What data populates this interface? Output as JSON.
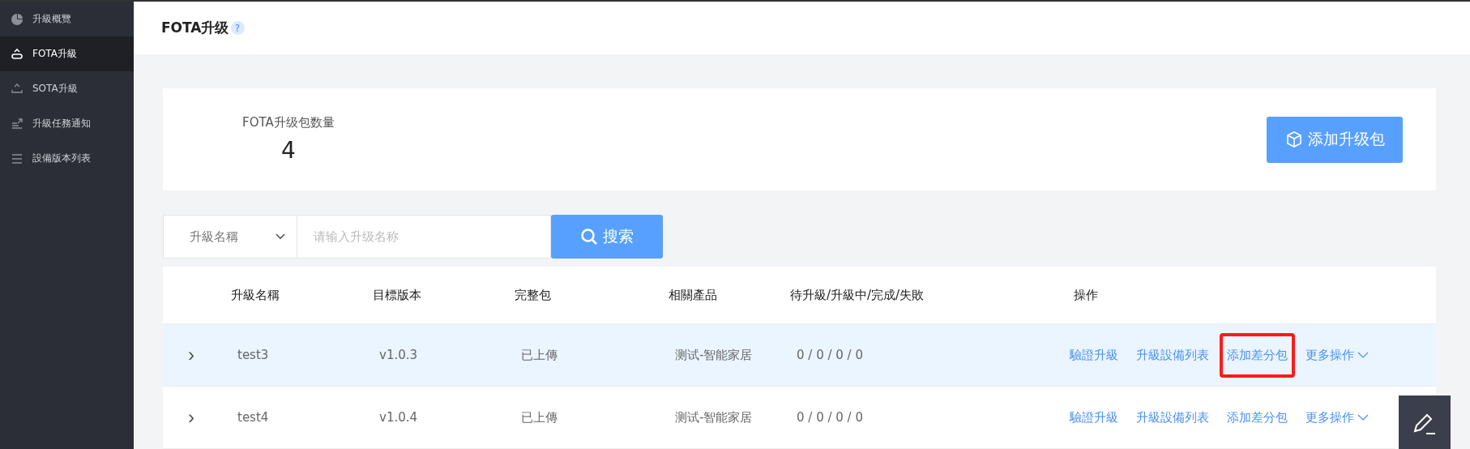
{
  "sidebar": {
    "items": [
      {
        "label": "升級概覽",
        "selected": false
      },
      {
        "label": "FOTA升級",
        "selected": true
      },
      {
        "label": "SOTA升級",
        "selected": false
      },
      {
        "label": "升級任務通知",
        "selected": false
      },
      {
        "label": "設備版本列表",
        "selected": false
      }
    ]
  },
  "header": {
    "title": "FOTA升级",
    "help": "?"
  },
  "stats": {
    "label": "FOTA升级包数量",
    "value": "4",
    "button": "添加升级包"
  },
  "search": {
    "field_select": "升級名稱",
    "placeholder": "请输入升级名称",
    "button": "搜索"
  },
  "table": {
    "columns": [
      "升級名稱",
      "目標版本",
      "完整包",
      "相關產品",
      "待升級/升級中/完成/失敗",
      "操作"
    ],
    "rows": [
      {
        "expander": "›",
        "selected": true,
        "cells": [
          "test3",
          "v1.0.3",
          "已上傳",
          "测试-智能家居",
          "0 / 0 / 0 / 0"
        ],
        "actions": [
          {
            "label": "驗證升級",
            "highlighted": false
          },
          {
            "label": "升級設備列表",
            "highlighted": false
          },
          {
            "label": "添加差分包",
            "highlighted": true
          },
          {
            "label": "更多操作",
            "highlighted": false,
            "kind": "dropdown"
          }
        ]
      },
      {
        "expander": "›",
        "selected": false,
        "cells": [
          "test4",
          "v1.0.4",
          "已上傳",
          "测试-智能家居",
          "0 / 0 / 0 / 0"
        ],
        "actions": [
          {
            "label": "驗證升級",
            "highlighted": false
          },
          {
            "label": "升級設備列表",
            "highlighted": false
          },
          {
            "label": "添加差分包",
            "highlighted": false
          },
          {
            "label": "更多操作",
            "highlighted": false,
            "kind": "dropdown"
          }
        ]
      }
    ]
  }
}
